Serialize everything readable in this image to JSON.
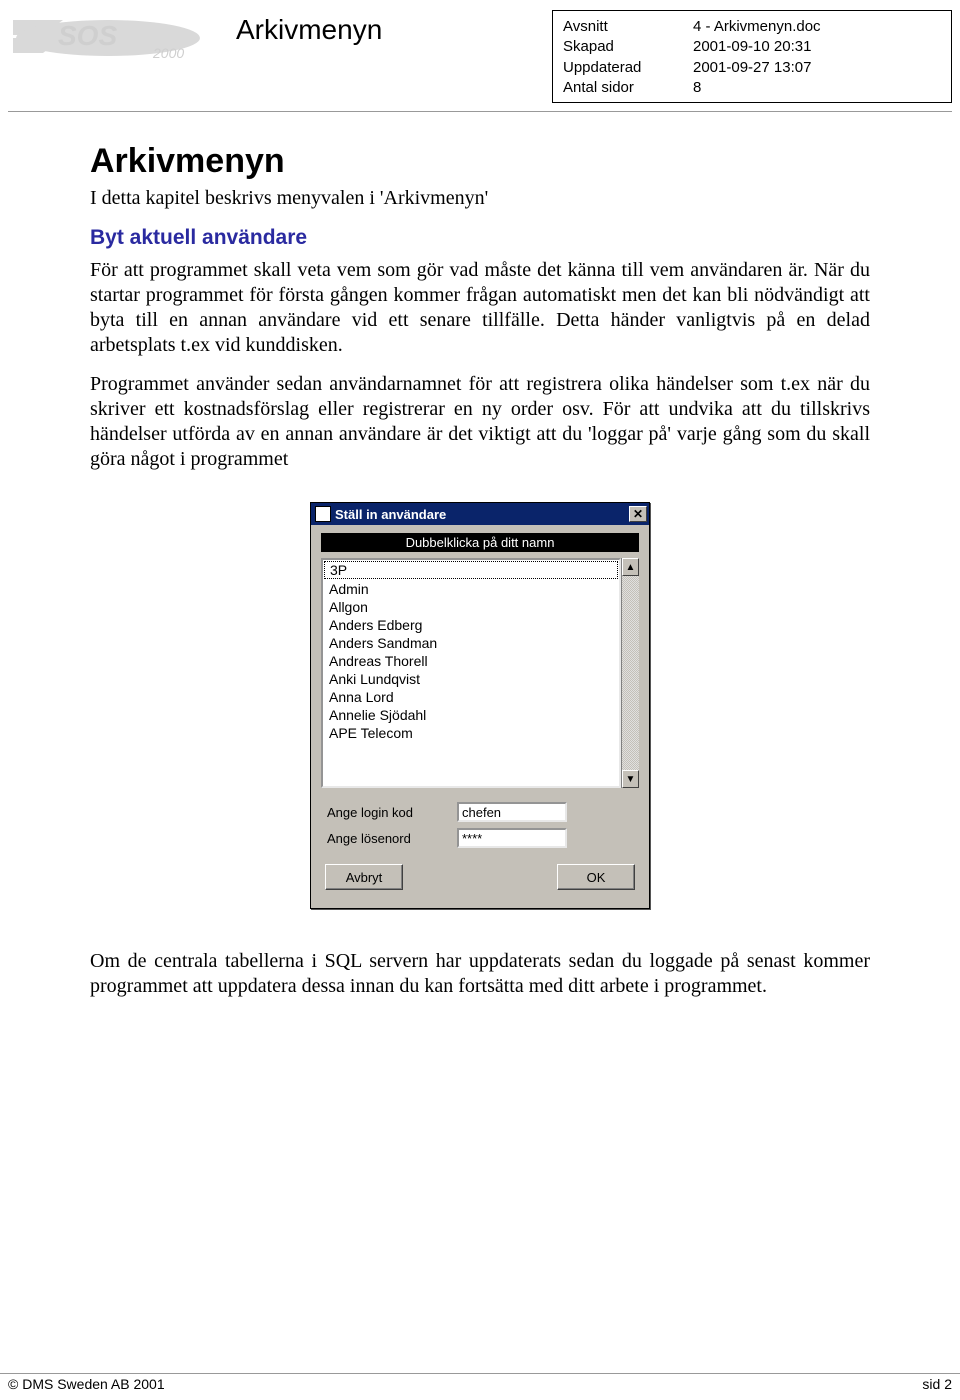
{
  "header": {
    "title": "Arkivmenyn",
    "meta": [
      {
        "label": "Avsnitt",
        "value": "4 - Arkivmenyn.doc"
      },
      {
        "label": "Skapad",
        "value": "2001-09-10 20:31"
      },
      {
        "label": "Uppdaterad",
        "value": "2001-09-27 13:07"
      },
      {
        "label": "Antal sidor",
        "value": "8"
      }
    ]
  },
  "body": {
    "h1": "Arkivmenyn",
    "intro": "I detta kapitel beskrivs menyvalen i 'Arkivmenyn'",
    "h2": "Byt aktuell användare",
    "para1": "För att programmet skall veta vem som gör vad måste det känna till vem användaren är. När du startar programmet för första gången kommer frågan automatiskt men det kan bli nödvändigt att byta till en annan användare vid ett senare tillfälle. Detta händer vanligtvis på en delad arbetsplats t.ex vid kunddisken.",
    "para2": "Programmet använder sedan användarnamnet för att registrera olika händelser som t.ex när du skriver ett kostnadsförslag eller registrerar en ny order osv. För att undvika att du tillskrivs händelser utförda av en annan användare är det viktigt att du 'loggar på' varje gång som du skall göra något i programmet",
    "para3": "Om de centrala tabellerna i SQL servern har uppdaterats sedan du loggade på senast kommer programmet att uppdatera dessa innan du kan fortsätta med ditt arbete i programmet."
  },
  "dialog": {
    "title": "Ställ in användare",
    "banner": "Dubbelklicka på ditt namn",
    "list": [
      "3P",
      "Admin",
      "Allgon",
      "Anders Edberg",
      "Anders Sandman",
      "Andreas Thorell",
      "Anki Lundqvist",
      "Anna Lord",
      "Annelie Sjödahl",
      "APE Telecom"
    ],
    "selected_index": 0,
    "login_label": "Ange login kod",
    "login_value": "chefen",
    "password_label": "Ange lösenord",
    "password_value": "****",
    "cancel": "Avbryt",
    "ok": "OK"
  },
  "footer": {
    "left": "© DMS Sweden AB 2001",
    "right": "sid 2"
  }
}
